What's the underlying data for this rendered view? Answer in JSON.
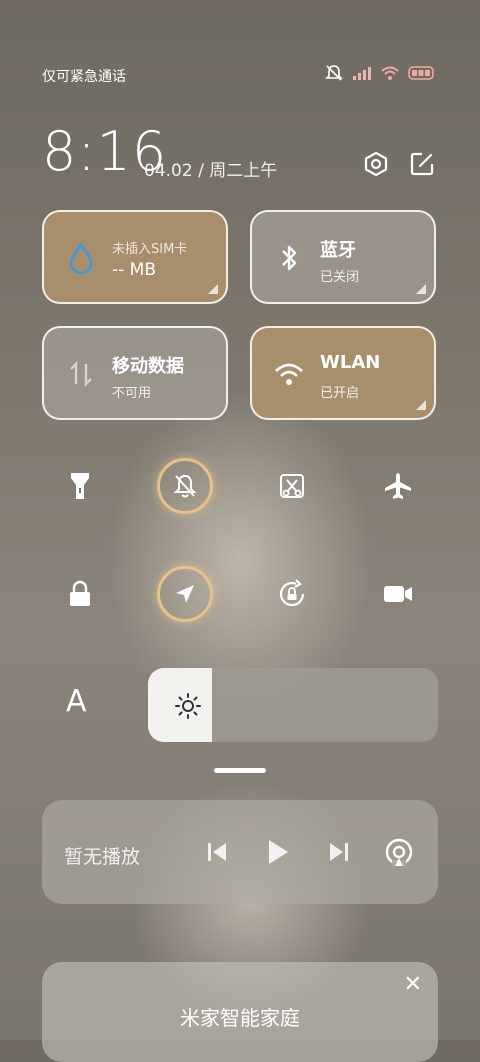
{
  "status_bar": {
    "carrier_text": "仅可紧急通话",
    "icons": [
      "mute-icon",
      "signal-icon",
      "wifi-icon",
      "battery-icon"
    ]
  },
  "header": {
    "time": "8:16",
    "date": "04.02 / 周二上午",
    "icons": [
      "settings-icon",
      "edit-icon"
    ]
  },
  "tiles": [
    {
      "id": "sim-data",
      "title": "未插入SIM卡",
      "value": "-- MB",
      "icon": "water-drop-icon",
      "state": "active",
      "color": "#ad916c"
    },
    {
      "id": "bluetooth",
      "title": "蓝牙",
      "sub": "已关闭",
      "icon": "bluetooth-icon",
      "state": "off",
      "color": "#a09a91"
    },
    {
      "id": "mobile-data",
      "title": "移动数据",
      "sub": "不可用",
      "icon": "data-arrows-icon",
      "state": "off",
      "color": "#a09a91"
    },
    {
      "id": "wlan",
      "title": "WLAN",
      "sub": "已开启",
      "icon": "wifi-icon",
      "state": "on",
      "color": "#ad916c"
    }
  ],
  "quick_toggles_row1": [
    {
      "icon": "flashlight-icon",
      "active": false
    },
    {
      "icon": "bell-off-icon",
      "active": true
    },
    {
      "icon": "screenshot-icon",
      "active": false
    },
    {
      "icon": "airplane-icon",
      "active": false
    }
  ],
  "quick_toggles_row2": [
    {
      "icon": "lock-icon",
      "active": false
    },
    {
      "icon": "location-icon",
      "active": true
    },
    {
      "icon": "rotation-lock-icon",
      "active": false
    },
    {
      "icon": "video-camera-icon",
      "active": false
    }
  ],
  "brightness": {
    "auto_label": "A",
    "level": 0.22
  },
  "media": {
    "label": "暂无播放",
    "icons": [
      "previous-icon",
      "play-icon",
      "next-icon",
      "cast-icon"
    ]
  },
  "smart_home": {
    "title": "米家智能家庭",
    "close_label": "✕"
  },
  "colors": {
    "accent_ring": "#e9c48c",
    "tile_tan": "#ad916c",
    "tile_grey": "#a09a91"
  }
}
